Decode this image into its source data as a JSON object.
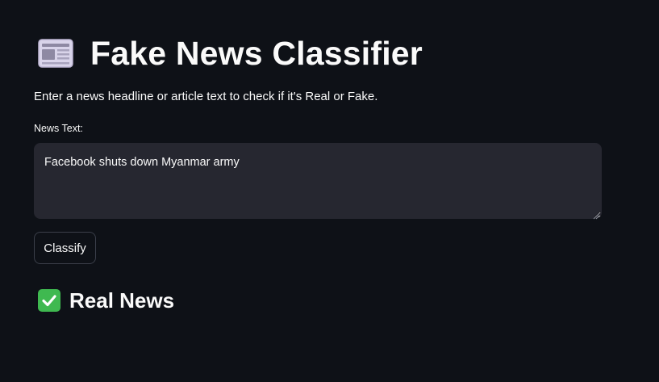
{
  "header": {
    "icon": "newspaper-icon",
    "title": "Fake News Classifier"
  },
  "description": "Enter a news headline or article text to check if it's Real or Fake.",
  "input": {
    "label": "News Text:",
    "value": "Facebook shuts down Myanmar army"
  },
  "button": {
    "label": "Classify"
  },
  "result": {
    "icon": "check-mark-icon",
    "label": "Real News",
    "status_color": "#3fb950"
  },
  "colors": {
    "background": "#0e1117",
    "input_background": "#262730",
    "text": "#fafafa"
  }
}
